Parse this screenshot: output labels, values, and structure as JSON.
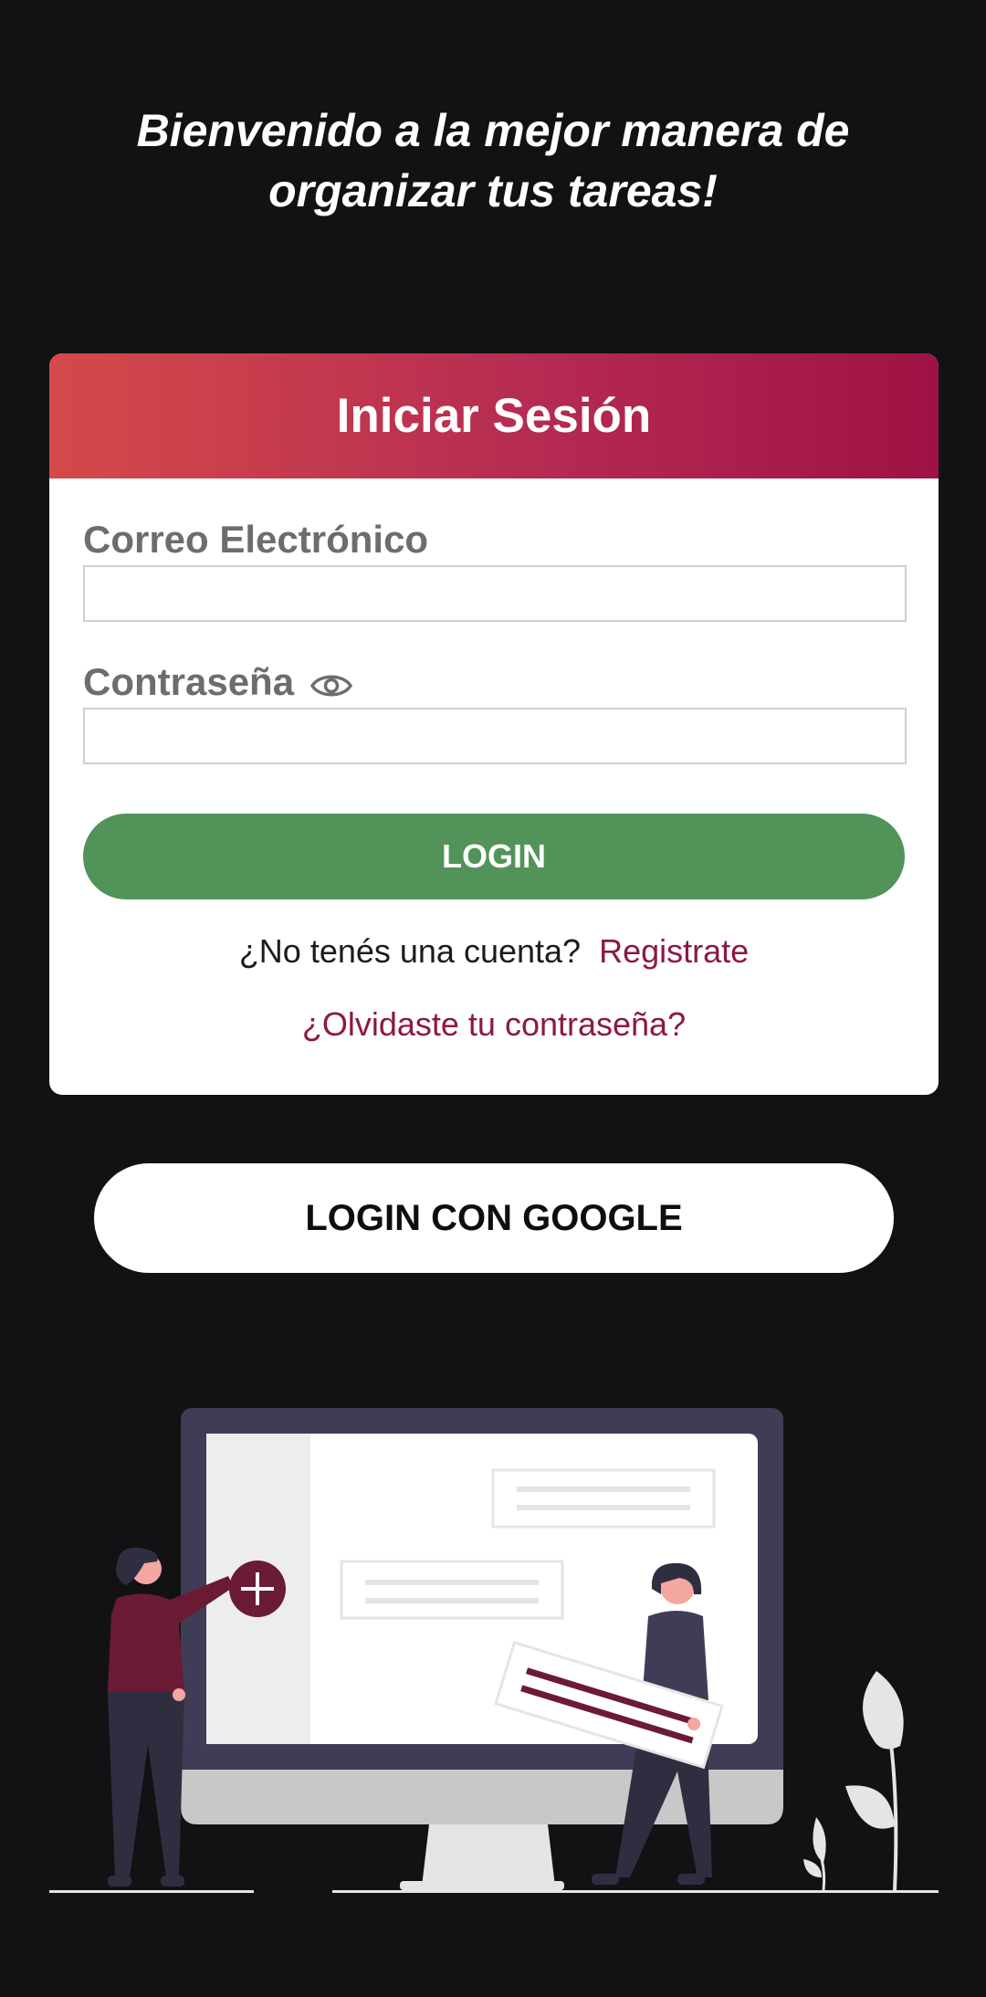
{
  "welcome": {
    "line1": "Bienvenido a la mejor manera de",
    "line2": "organizar tus tareas!"
  },
  "login_card": {
    "title": "Iniciar Sesión",
    "email_label": "Correo Electrónico",
    "email_value": "",
    "password_label": "Contraseña",
    "password_value": "",
    "login_button": "LOGIN",
    "no_account_text": "¿No tenés una cuenta?",
    "register_link": "Registrate",
    "forgot_password": "¿Olvidaste tu contraseña?"
  },
  "google_button": "LOGIN CON GOOGLE",
  "icons": {
    "password_toggle": "eye-icon",
    "illustration_add": "plus-circle-icon"
  },
  "colors": {
    "background": "#121214",
    "header_gradient_start": "#d44a4a",
    "header_gradient_end": "#9e1245",
    "login_button": "#52935a",
    "link": "#8c1846"
  }
}
